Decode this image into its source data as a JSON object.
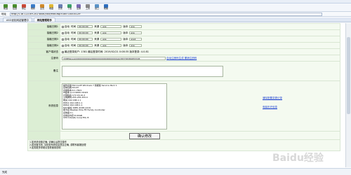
{
  "browser": {
    "toolbar": [
      "前进",
      "后退",
      "停止",
      "刷新",
      "主页",
      "收藏",
      "历史",
      "下载",
      "全屏",
      "工具",
      "窗口",
      "帮助"
    ],
    "address_label": "地址",
    "address": "http://116.122.89.202:8080/usr/edit.asp?uid=10000129",
    "tabs": [
      "ASO优化网站管理中",
      "网站管理助手"
    ]
  },
  "form": {
    "schedule_rows": [
      {
        "label": "接触日期1",
        "check": "自动",
        "time_label": "时间",
        "time": "00:00:00",
        "src_label": "来源",
        "src": ".exe",
        "tail_label": "版本",
        "tail": "exe"
      },
      {
        "label": "接触日期2",
        "check": "自动",
        "time_label": "时间",
        "time": "00:00:00",
        "src_label": "来源",
        "src": ".exe",
        "tail_label": "版本",
        "tail": "exe"
      },
      {
        "label": "接触日期3",
        "check": "自动",
        "time_label": "时间",
        "time": "00:00:00",
        "src_label": "来源",
        "src": ".exe",
        "tail_label": "版本",
        "tail": "exe1"
      },
      {
        "label": "接触日期4",
        "check": "自动",
        "time_label": "时间",
        "time": "00:00:00",
        "src_label": "来源",
        "src": ".exe",
        "tail_label": "版本",
        "tail": "exe"
      }
    ],
    "client_label": "客户端状态",
    "client_text": "最近登录用户: 1381 最后登录时间: 2019/02/21 0:08:35 版本登录: 4.0.81",
    "reg_label": "注册码",
    "reg_value": "338E64AA10000000000A00000000000000000000Ab383758386855538",
    "reg_link": "自动注册码生成 撤销注册码",
    "remark_label": "备注",
    "sysinfo_label": "系统信息",
    "sysinfo_lines": [
      "操作系统:Microsoft Windows 7 旗舰版 Service Pack 1",
      "系统位数:64-bit",
      "系统版本:6.1.7601",
      "IE版本:11.0.9600.16421",
      "计算机名:172.16.10.2",
      "子网掩码:255.255.255.0",
      "网关:192.168.1.1",
      "DNS1:192.168.1.1",
      "DNS2:192.168.1.1",
      "MAC地址:00E0-4C68-A419",
      "网卡名:Realtek PCIe FE Family Controller",
      "系统盘:C:\\",
      "系统总内存:8.00GB",
      "CPU:Intel(R) Core(TM) i5"
    ],
    "side_links": [
      "清除配置变更记录",
      "电脑历史信息"
    ],
    "submit": "确认修改",
    "footnotes": [
      "1.如系统设置正确, 请确认后提交操作",
      "2.若设置无效, 请检查系统信息是否正确, 或联系客服处理",
      "3.如需更多帮助请查看使用说明"
    ]
  },
  "status": "完成",
  "watermark": "Baidu经验"
}
